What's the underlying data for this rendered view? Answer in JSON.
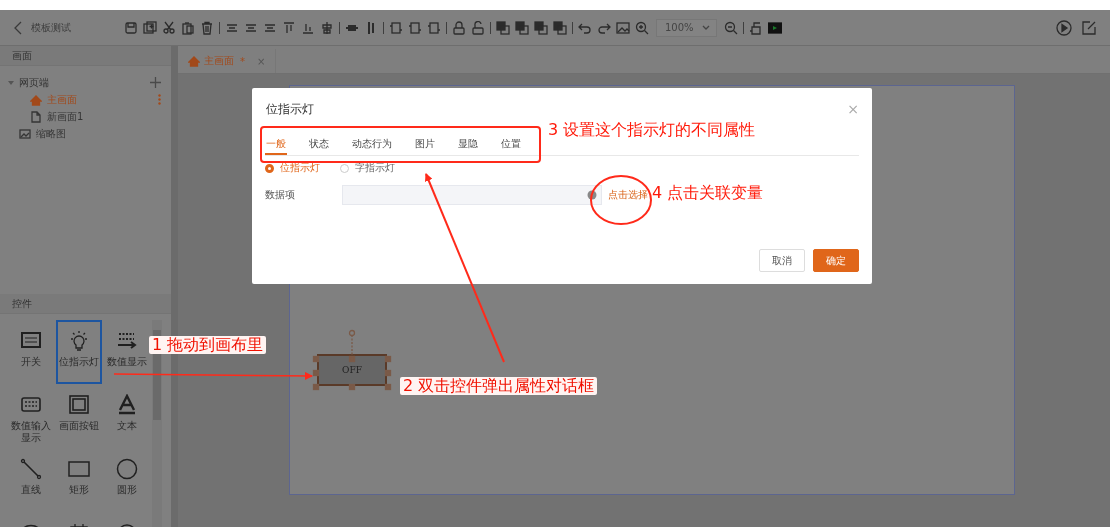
{
  "window": {
    "title": "模板测试"
  },
  "toolbar": {
    "zoom": "100%"
  },
  "sidebar": {
    "title": "画面",
    "tree": [
      {
        "label": "网页端",
        "kind": "folder",
        "selected": false,
        "expanded": true,
        "children": [
          {
            "label": "主画面",
            "kind": "home",
            "selected": true
          },
          {
            "label": "新画面1",
            "kind": "page",
            "selected": false
          }
        ]
      },
      {
        "label": "缩略图",
        "kind": "thumb",
        "selected": false
      }
    ]
  },
  "controls": {
    "title": "控件",
    "items": [
      {
        "label": "开关",
        "kind": "btn",
        "selected": false
      },
      {
        "label": "位指示灯",
        "kind": "bulb",
        "selected": true
      },
      {
        "label": "数值显示",
        "kind": "number",
        "selected": false
      },
      {
        "label": "数值输入显示",
        "kind": "numbox",
        "selected": false
      },
      {
        "label": "画面按钮",
        "kind": "frame",
        "selected": false
      },
      {
        "label": "文本",
        "kind": "text",
        "selected": false
      },
      {
        "label": "直线",
        "kind": "line",
        "selected": false
      },
      {
        "label": "矩形",
        "kind": "rect",
        "selected": false
      },
      {
        "label": "圆形",
        "kind": "circle",
        "selected": false
      },
      {
        "kind": "mask",
        "selected": false
      },
      {
        "kind": "calendar",
        "selected": false
      },
      {
        "kind": "gauge",
        "selected": false
      }
    ]
  },
  "tabs": [
    {
      "label": "主画面",
      "mark": "*",
      "selected": true,
      "close": "×"
    }
  ],
  "canvas": {
    "widget": {
      "label": "OFF",
      "selected": true
    }
  },
  "dialog": {
    "title": "位指示灯",
    "close": "×",
    "tabs": [
      {
        "label": "一般",
        "selected": true
      },
      {
        "label": "状态",
        "selected": false
      },
      {
        "label": "动态行为",
        "selected": false
      },
      {
        "label": "图片",
        "selected": false
      },
      {
        "label": "显隐",
        "selected": false
      },
      {
        "label": "位置",
        "selected": false
      }
    ],
    "radios": [
      {
        "label": "位指示灯",
        "selected": true
      },
      {
        "label": "字指示灯",
        "selected": false
      }
    ],
    "field": {
      "label": "数据项",
      "link": "点击选择"
    },
    "buttons": [
      {
        "label": "取消",
        "kind": "secondary"
      },
      {
        "label": "确定",
        "kind": "primary"
      }
    ]
  },
  "annotations": [
    {
      "text": "1 拖动到画布里"
    },
    {
      "text": "2  双击控件弹出属性对话框"
    },
    {
      "text": "3 设置这个指示灯的不同属性"
    },
    {
      "text": "4 点击关联变量"
    }
  ]
}
